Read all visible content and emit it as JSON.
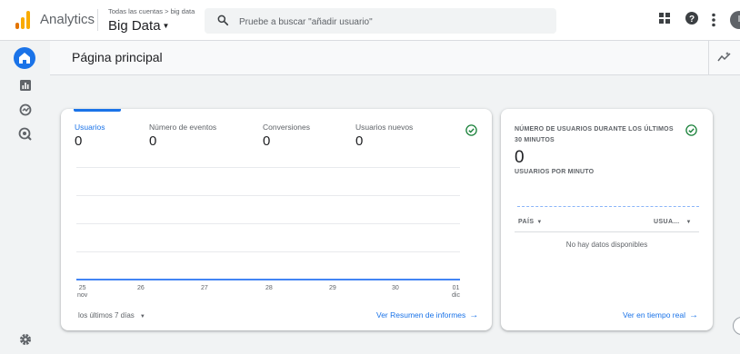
{
  "header": {
    "app_name": "Analytics",
    "breadcrumb": "Todas las cuentas > big data",
    "account_name": "Big Data",
    "search_placeholder": "Pruebe a buscar \"añadir usuario\"",
    "avatar_initial": "I"
  },
  "page": {
    "title": "Página principal"
  },
  "overview_card": {
    "metrics": [
      {
        "label": "Usuarios",
        "value": "0"
      },
      {
        "label": "Número de eventos",
        "value": "0"
      },
      {
        "label": "Conversiones",
        "value": "0"
      },
      {
        "label": "Usuarios nuevos",
        "value": "0"
      }
    ],
    "x_ticks": [
      {
        "day": "25",
        "month": "nov"
      },
      {
        "day": "26",
        "month": ""
      },
      {
        "day": "27",
        "month": ""
      },
      {
        "day": "28",
        "month": ""
      },
      {
        "day": "29",
        "month": ""
      },
      {
        "day": "30",
        "month": ""
      },
      {
        "day": "01",
        "month": "dic"
      }
    ],
    "date_range": "los últimos 7 días",
    "link": "Ver Resumen de informes"
  },
  "realtime_card": {
    "title": "NÚMERO DE USUARIOS DURANTE LOS ÚLTIMOS 30 MINUTOS",
    "value": "0",
    "subtitle": "USUARIOS POR MINUTO",
    "col_country": "PAÍS",
    "col_users": "USUA...",
    "empty": "No hay datos disponibles",
    "link": "Ver en tiempo real"
  },
  "colors": {
    "accent": "#1a73e8",
    "success": "#188038",
    "logo_orange": "#f9ab00",
    "logo_dark_orange": "#e37400"
  }
}
